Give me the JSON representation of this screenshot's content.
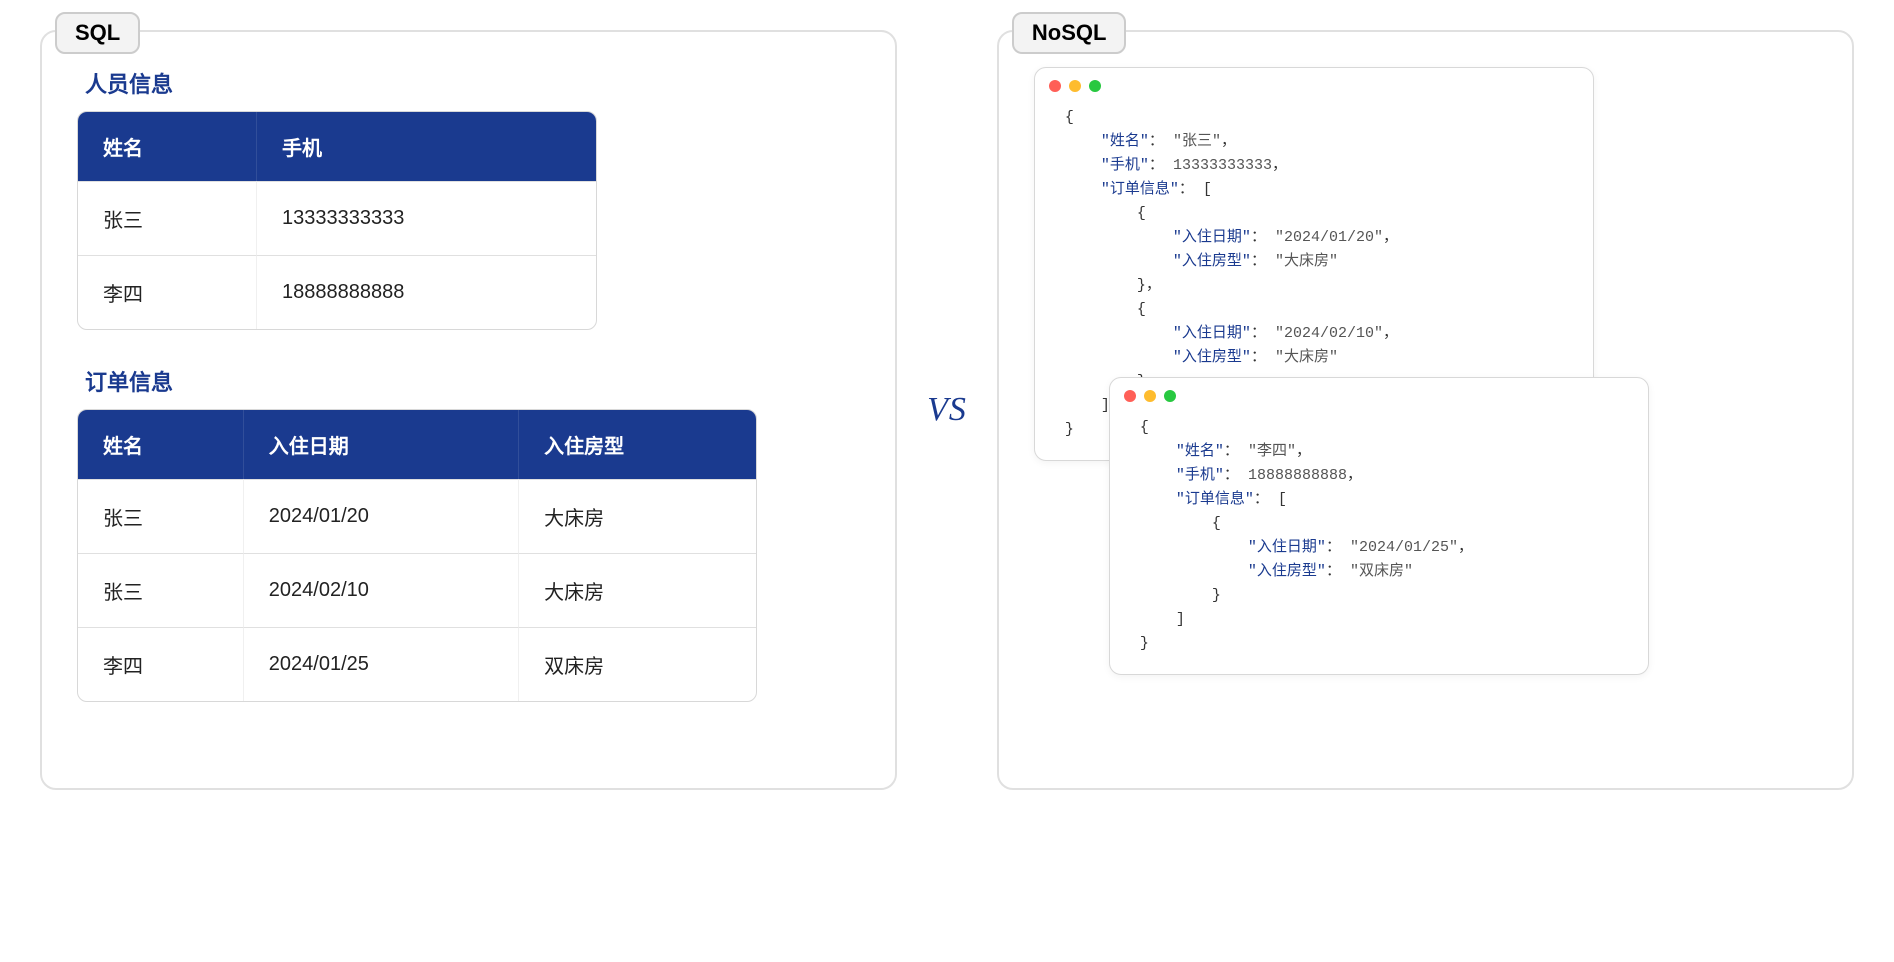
{
  "labels": {
    "sql": "SQL",
    "nosql": "NoSQL",
    "vs": "VS"
  },
  "sql": {
    "people": {
      "title": "人员信息",
      "headers": [
        "姓名",
        "手机"
      ],
      "rows": [
        [
          "张三",
          "13333333333"
        ],
        [
          "李四",
          "18888888888"
        ]
      ]
    },
    "orders": {
      "title": "订单信息",
      "headers": [
        "姓名",
        "入住日期",
        "入住房型"
      ],
      "rows": [
        [
          "张三",
          "2024/01/20",
          "大床房"
        ],
        [
          "张三",
          "2024/02/10",
          "大床房"
        ],
        [
          "李四",
          "2024/01/25",
          "双床房"
        ]
      ]
    }
  },
  "nosql": {
    "doc1": {
      "姓名": "张三",
      "手机": 13333333333,
      "订单信息": [
        {
          "入住日期": "2024/01/20",
          "入住房型": "大床房"
        },
        {
          "入住日期": "2024/02/10",
          "入住房型": "大床房"
        }
      ]
    },
    "doc2": {
      "姓名": "李四",
      "手机": 18888888888,
      "订单信息": [
        {
          "入住日期": "2024/01/25",
          "入住房型": "双床房"
        }
      ]
    }
  },
  "colors": {
    "brand_blue": "#1a3a8f",
    "traffic_red": "#ff5f57",
    "traffic_yellow": "#febc2e",
    "traffic_green": "#28c840"
  }
}
